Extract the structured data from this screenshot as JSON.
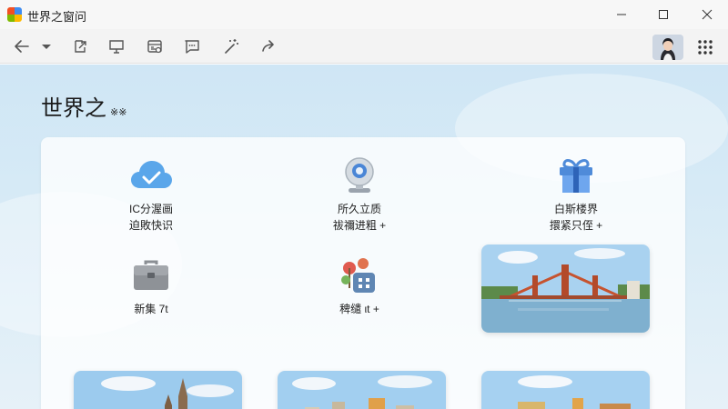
{
  "window": {
    "title": "世界之窗问"
  },
  "toolbar": {
    "buttons": [
      {
        "name": "back-button",
        "icon": "arrow-left-icon"
      },
      {
        "name": "history-dropdown-button",
        "icon": "chevron-down-icon"
      },
      {
        "name": "share-button",
        "icon": "share-icon"
      },
      {
        "name": "cast-button",
        "icon": "cast-icon"
      },
      {
        "name": "calendar-button",
        "icon": "calendar-icon"
      },
      {
        "name": "chat-button",
        "icon": "chat-icon"
      },
      {
        "name": "magic-button",
        "icon": "magic-wand-icon"
      },
      {
        "name": "forward-button",
        "icon": "forward-arrow-icon"
      }
    ]
  },
  "page": {
    "title": "世界之",
    "title_suffix": "※※"
  },
  "tiles": [
    {
      "id": "cloud",
      "icon": "cloud-check-icon",
      "line1": "IC分渥画",
      "line2": "迫敗快识"
    },
    {
      "id": "camera",
      "icon": "webcam-icon",
      "line1": "所久立质",
      "line2": "祓禰进粗 +"
    },
    {
      "id": "gift",
      "icon": "gift-icon",
      "line1": "白斯楼界",
      "line2": "擐紧只侄 +"
    },
    {
      "id": "briefcase",
      "icon": "briefcase-icon",
      "line1": "新集 7t",
      "line2": ""
    },
    {
      "id": "map",
      "icon": "map-pin-icon",
      "line1": "稗缱 ιt +",
      "line2": ""
    }
  ],
  "colors": {
    "accent": "#4a90e2",
    "background": "#d8ebf6",
    "panel": "#ffffff"
  }
}
